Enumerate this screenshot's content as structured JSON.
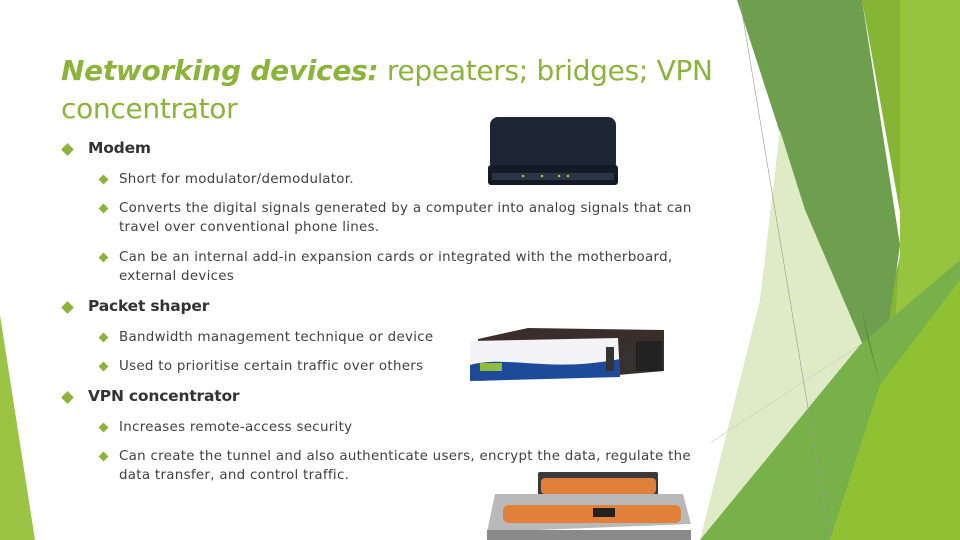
{
  "slide": {
    "title_emphasis": "Networking devices:",
    "title_rest": " repeaters; bridges; VPN concentrator",
    "sections": [
      {
        "heading": "Modem",
        "bullets": [
          "Short for modulator/demodulator.",
          "Converts the digital signals generated by a computer into analog signals that can travel over conventional phone lines.",
          "Can be an internal add-in expansion cards or integrated with the motherboard, external devices"
        ]
      },
      {
        "heading": "Packet shaper",
        "bullets": [
          "Bandwidth management technique or device",
          "Used to prioritise certain traffic over others"
        ]
      },
      {
        "heading": "VPN concentrator",
        "bullets": [
          "Increases remote-access security",
          "Can create the tunnel and also authenticate users, encrypt the data, regulate the data transfer, and control traffic."
        ]
      }
    ]
  },
  "colors": {
    "accent": "#8cb43a",
    "dark_green": "#6a9a48",
    "text": "#404040"
  }
}
